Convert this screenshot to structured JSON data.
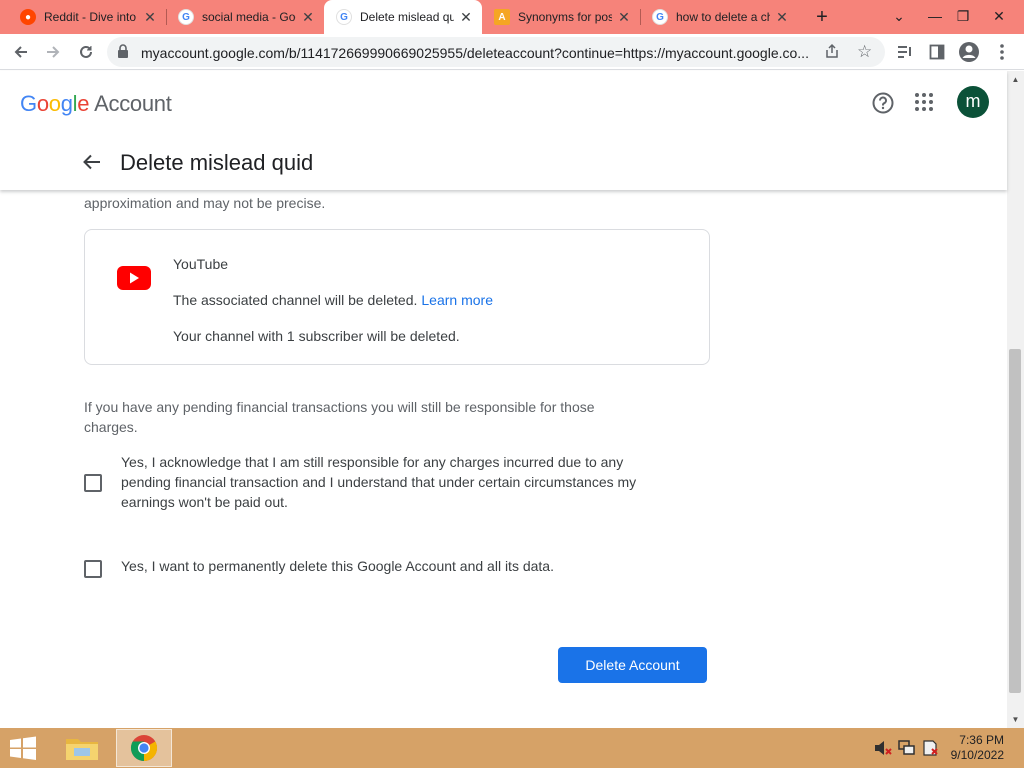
{
  "browser": {
    "tabs": [
      {
        "title": "Reddit - Dive into anything",
        "icon": "reddit-icon",
        "active": false
      },
      {
        "title": "social media - Google Search",
        "icon": "google-icon",
        "active": false
      },
      {
        "title": "Delete mislead quid",
        "icon": "google-icon",
        "active": true
      },
      {
        "title": "Synonyms for post",
        "icon": "synonyms-icon",
        "active": false
      },
      {
        "title": "how to delete a channel",
        "icon": "google-icon",
        "active": false
      }
    ],
    "new_tab": "+",
    "url": "myaccount.google.com/b/114172669990669025955/deleteaccount?continue=https://myaccount.google.co...",
    "tabstrip_color": "#f6837a"
  },
  "header": {
    "logo": {
      "g1": "G",
      "g2": "o",
      "g3": "o",
      "g4": "g",
      "g5": "l",
      "g6": "e",
      "account": "Account"
    },
    "avatar_letter": "m",
    "avatar_color": "#0b5138",
    "page_title": "Delete mislead quid"
  },
  "content": {
    "approx_text": "approximation and may not be precise.",
    "youtube": {
      "name": "YouTube",
      "line1": "The associated channel will be deleted.",
      "learn_more": "Learn more",
      "line2": "Your channel with 1 subscriber will be deleted."
    },
    "pending_text": "If you have any pending financial transactions you will still be responsible for those charges.",
    "checkbox1_label": "Yes, I acknowledge that I am still responsible for any charges incurred due to any pending financial transaction and I understand that under certain circumstances my earnings won't be paid out.",
    "checkbox1_checked": false,
    "checkbox2_label": "Yes, I want to permanently delete this Google Account and all its data.",
    "checkbox2_checked": false,
    "delete_button": "Delete Account",
    "accent_color": "#1a73e8"
  },
  "taskbar": {
    "time": "7:36 PM",
    "date": "9/10/2022",
    "color": "#d6a267"
  }
}
